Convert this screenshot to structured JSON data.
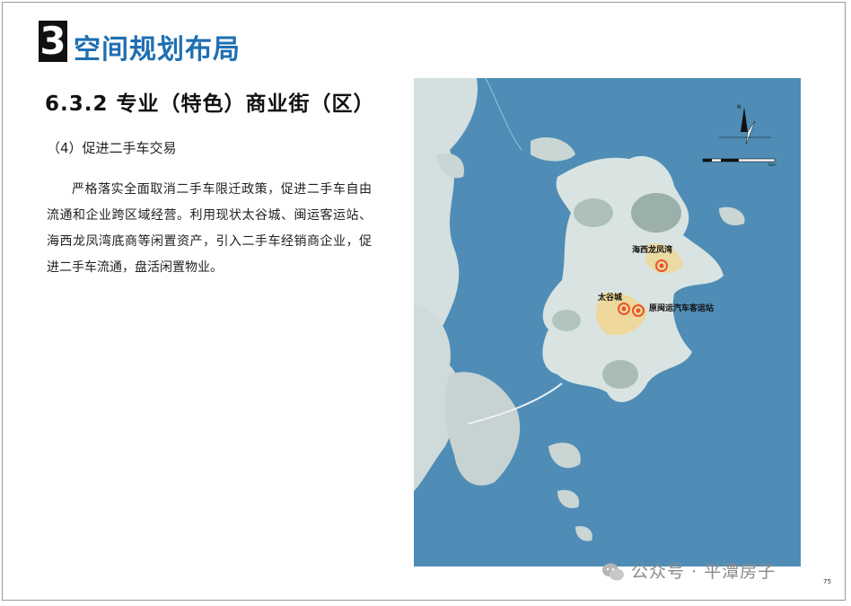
{
  "header": {
    "section_number": "3",
    "section_title": "空间规划布局"
  },
  "content": {
    "subsection_title": "6.3.2 专业（特色）商业街（区）",
    "item_heading": "（4）促进二手车交易",
    "paragraph": "严格落实全面取消二手车限迁政策，促进二手车自由流通和企业跨区域经营。利用现状太谷城、闽运客运站、海西龙凤湾底商等闲置资产，引入二手车经销商企业，促进二手车流通，盘活闲置物业。"
  },
  "map": {
    "north_label": "N",
    "scale_unit": "0km",
    "labels": {
      "haixi": "海西龙凤湾",
      "taigu": "太谷城",
      "minyun": "原闽运汽车客运站"
    },
    "colors": {
      "sea": "#4f8db6",
      "land": "#d9e4e2",
      "marker": "#e8542a"
    }
  },
  "footer": {
    "account": "公众号 · 平潭房子",
    "page_number": "75"
  }
}
